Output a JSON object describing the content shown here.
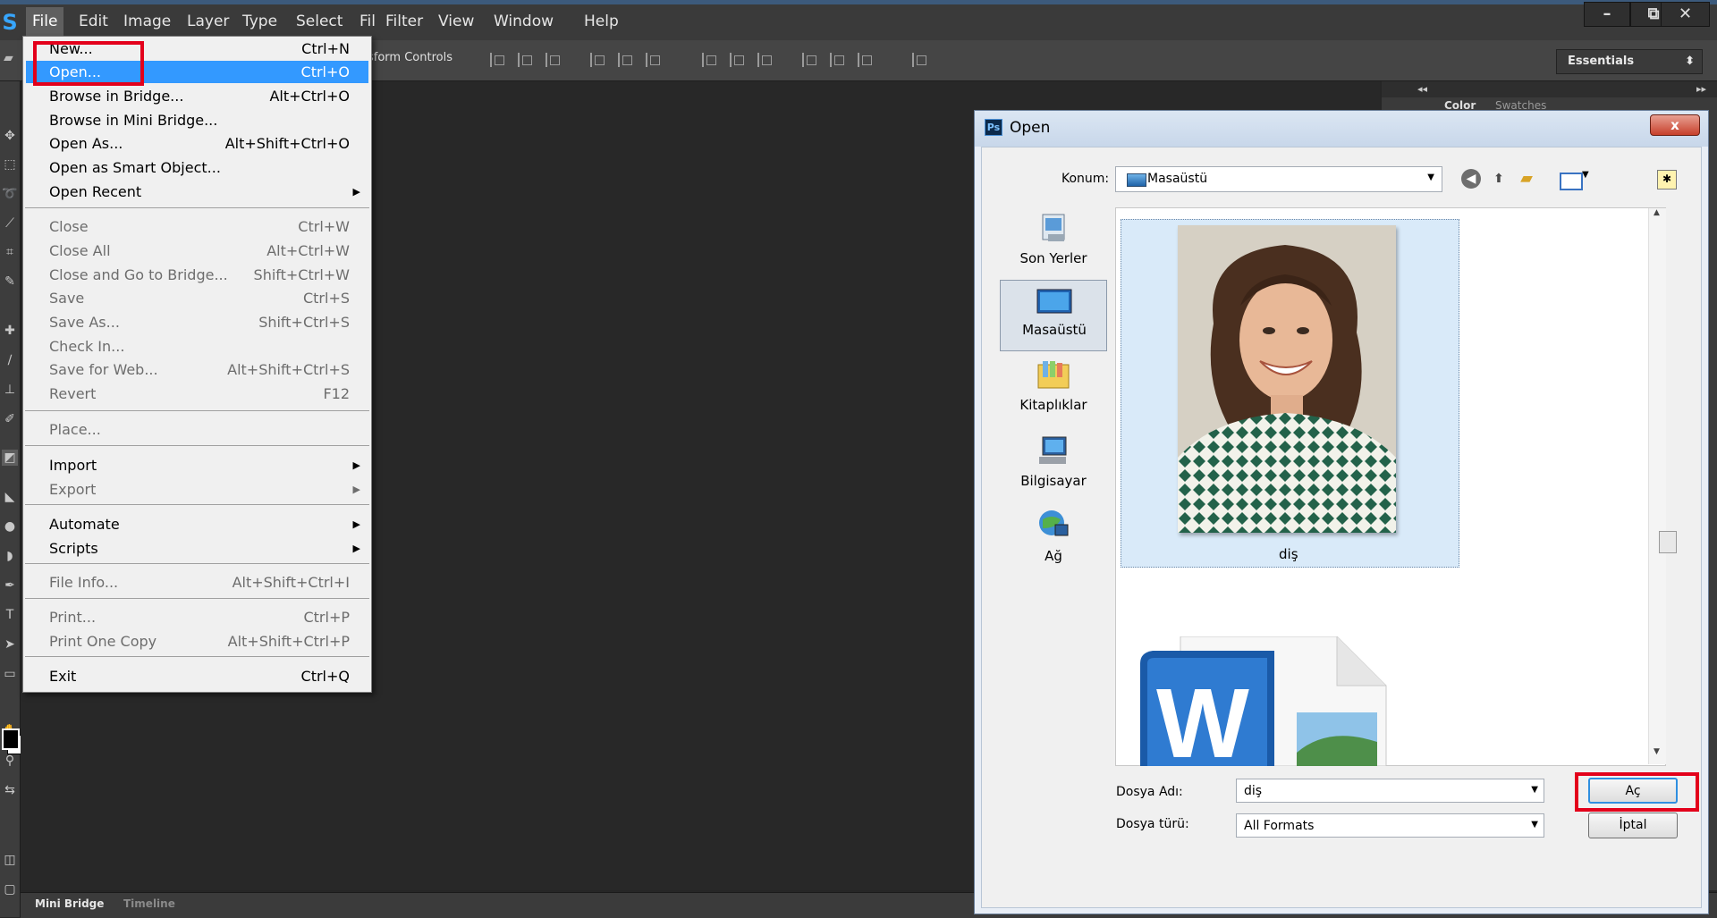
{
  "app": {
    "logo": "S",
    "menu": [
      "File",
      "Edit",
      "Image",
      "Layer",
      "Type",
      "Select",
      "Fil",
      "Filter",
      "View",
      "Window",
      "Help"
    ],
    "window_controls": [
      "–",
      "⧉",
      "✕"
    ],
    "options_bar": {
      "transform_label": "sform Controls"
    },
    "workspace": "Essentials",
    "bottom_tabs": [
      "Mini Bridge",
      "Timeline"
    ],
    "right_panel_tabs": [
      "Color",
      "Swatches"
    ],
    "panel_collapse": "◂◂",
    "panel_expand": "▸▸"
  },
  "file_menu": {
    "items": [
      {
        "label": "New...",
        "shortcut": "Ctrl+N"
      },
      {
        "label": "Open...",
        "shortcut": "Ctrl+O"
      },
      {
        "label": "Browse in Bridge...",
        "shortcut": "Alt+Ctrl+O"
      },
      {
        "label": "Browse in Mini Bridge...",
        "shortcut": ""
      },
      {
        "label": "Open As...",
        "shortcut": "Alt+Shift+Ctrl+O"
      },
      {
        "label": "Open as Smart Object...",
        "shortcut": ""
      },
      {
        "label": "Open Recent",
        "shortcut": ""
      },
      {
        "label": "Close",
        "shortcut": "Ctrl+W"
      },
      {
        "label": "Close All",
        "shortcut": "Alt+Ctrl+W"
      },
      {
        "label": "Close and Go to Bridge...",
        "shortcut": "Shift+Ctrl+W"
      },
      {
        "label": "Save",
        "shortcut": "Ctrl+S"
      },
      {
        "label": "Save As...",
        "shortcut": "Shift+Ctrl+S"
      },
      {
        "label": "Check In...",
        "shortcut": ""
      },
      {
        "label": "Save for Web...",
        "shortcut": "Alt+Shift+Ctrl+S"
      },
      {
        "label": "Revert",
        "shortcut": "F12"
      },
      {
        "label": "Place...",
        "shortcut": ""
      },
      {
        "label": "Import",
        "shortcut": ""
      },
      {
        "label": "Export",
        "shortcut": ""
      },
      {
        "label": "Automate",
        "shortcut": ""
      },
      {
        "label": "Scripts",
        "shortcut": ""
      },
      {
        "label": "File Info...",
        "shortcut": "Alt+Shift+Ctrl+I"
      },
      {
        "label": "Print...",
        "shortcut": "Ctrl+P"
      },
      {
        "label": "Print One Copy",
        "shortcut": "Alt+Shift+Ctrl+P"
      },
      {
        "label": "Exit",
        "shortcut": "Ctrl+Q"
      }
    ]
  },
  "dialog": {
    "ps_badge": "Ps",
    "title": "Open",
    "close": "x",
    "location_label": "Konum:",
    "location_value": "Masaüstü",
    "places": [
      "Son Yerler",
      "Masaüstü",
      "Kitaplıklar",
      "Bilgisayar",
      "Ağ"
    ],
    "files": [
      {
        "name": "diş"
      }
    ],
    "filename_label": "Dosya Adı:",
    "filename_value": "diş",
    "filetype_label": "Dosya türü:",
    "filetype_value": "All Formats",
    "open_button": "Aç",
    "cancel_button": "İptal"
  },
  "colors": {
    "accent": "#3399ff",
    "highlight_box": "#e3001b",
    "photoshop_bg": "#262626"
  }
}
